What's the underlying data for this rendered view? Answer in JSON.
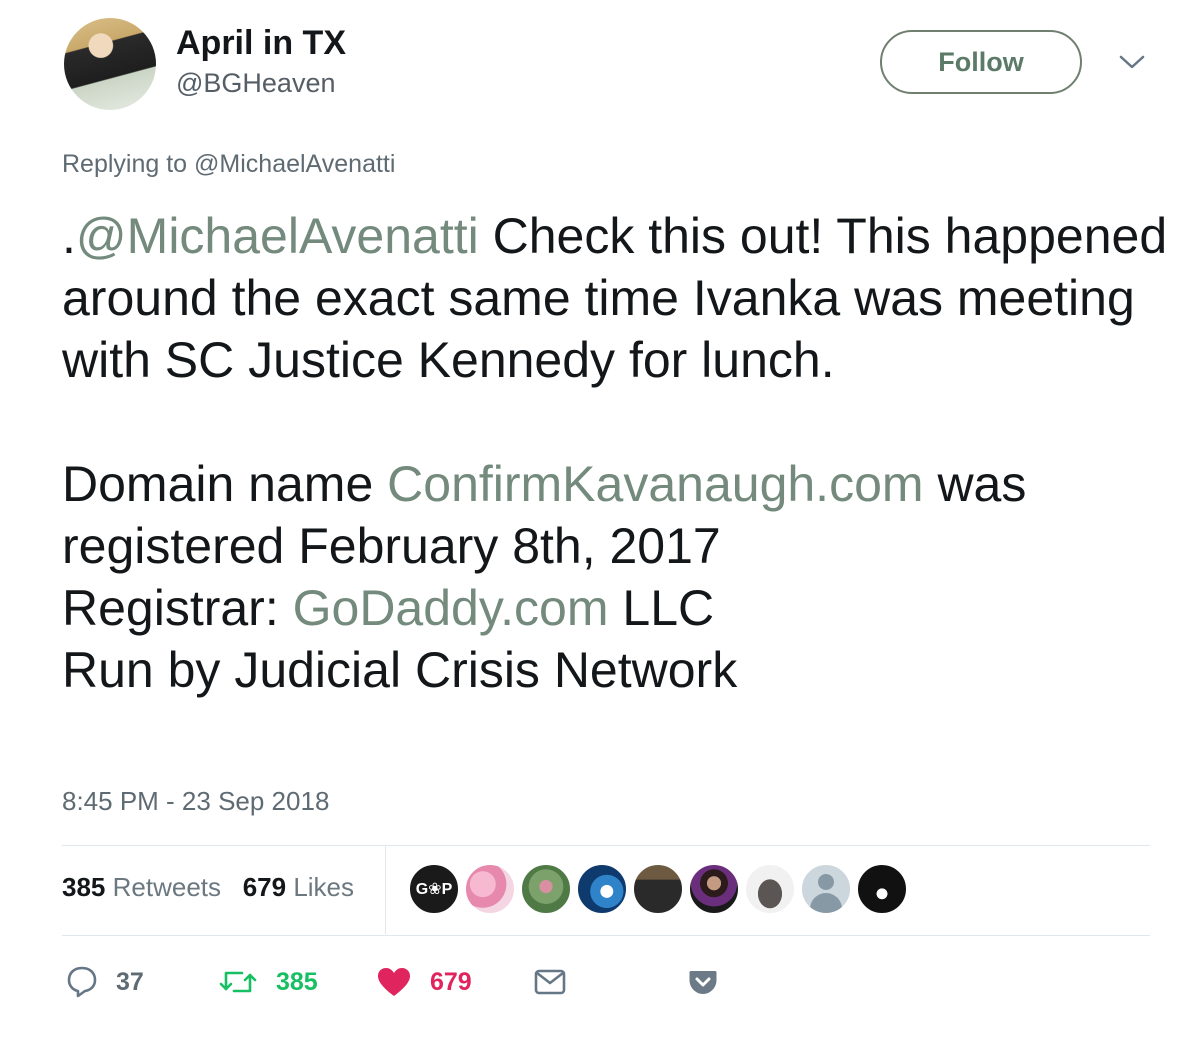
{
  "author": {
    "display_name": "April in TX",
    "handle": "@BGHeaven",
    "avatar": "profile-photo"
  },
  "follow_button": {
    "label": "Follow"
  },
  "menu_icon": "chevron-down-icon",
  "replying_to": {
    "prefix": "Replying to",
    "mention": "@MichaelAvenatti"
  },
  "tweet": {
    "line1_prefix": ".",
    "mention": "@MichaelAvenatti",
    "line1_rest": " Check this out! This happened around the exact same time Ivanka was meeting with SC Justice Kennedy for lunch.",
    "domain_prefix": "Domain name ",
    "domain_link": "ConfirmKavanaugh.com",
    "domain_suffix": " was registered February 8th, 2017",
    "registrar_prefix": "Registrar: ",
    "registrar_link": "GoDaddy.com",
    "registrar_suffix": " LLC",
    "run_by": "Run by Judicial Crisis Network"
  },
  "timestamp": "8:45 PM - 23 Sep 2018",
  "stats": {
    "retweets_count": "385",
    "retweets_label": "Retweets",
    "likes_count": "679",
    "likes_label": "Likes"
  },
  "liker_avatars": {
    "first_avatar_text": "G❀P"
  },
  "actions": {
    "reply_count": "37",
    "retweet_count": "385",
    "like_count": "679"
  },
  "colors": {
    "link": "#738a7d",
    "retweet_green": "#17bf63",
    "like_red": "#e0245e",
    "secondary_text": "#5f6b73"
  }
}
